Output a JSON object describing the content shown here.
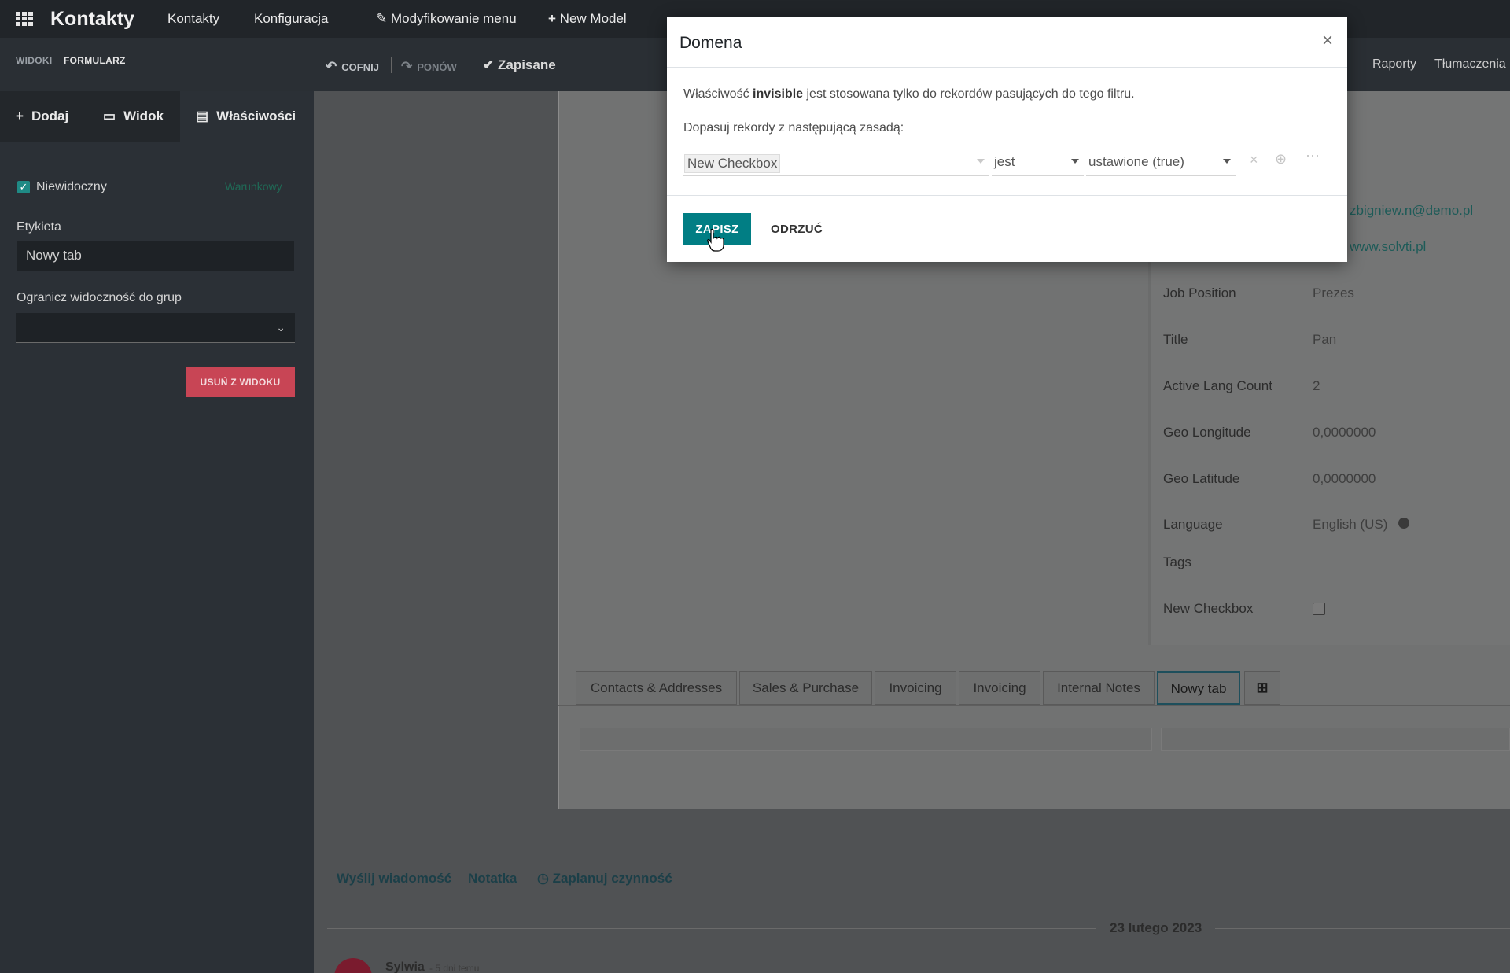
{
  "topbar": {
    "app_name": "Kontakty",
    "nav": [
      "Kontakty",
      "Konfiguracja",
      "Modyfikowanie menu",
      "New Model"
    ]
  },
  "studio": {
    "breadcrumb": [
      "WIDOKI",
      "FORMULARZ"
    ],
    "undo": "COFNIJ",
    "redo": "PONÓW",
    "saved": "Zapisane",
    "right_nav": [
      "Raporty",
      "Tłumaczenia"
    ]
  },
  "sidebar": {
    "tabs": [
      "Dodaj",
      "Widok",
      "Właściwości"
    ],
    "invisible_label": "Niewidoczny",
    "conditional_label": "Warunkowy",
    "label_heading": "Etykieta",
    "label_value": "Nowy tab",
    "groups_heading": "Ogranicz widoczność do grup",
    "remove_button": "USUŃ Z WIDOKU"
  },
  "form": {
    "email": "zbigniew.n@demo.pl",
    "website": "www.solvti.pl",
    "fields": [
      {
        "label": "Job Position",
        "value": "Prezes"
      },
      {
        "label": "Title",
        "value": "Pan"
      },
      {
        "label": "Active Lang Count",
        "value": "2"
      },
      {
        "label": "Geo Longitude",
        "value": "0,0000000"
      },
      {
        "label": "Geo Latitude",
        "value": "0,0000000"
      },
      {
        "label": "Language",
        "value": "English (US)"
      },
      {
        "label": "Tags",
        "value": ""
      },
      {
        "label": "New Checkbox",
        "value": ""
      }
    ],
    "tabs": [
      "Contacts & Addresses",
      "Sales & Purchase",
      "Invoicing",
      "Invoicing",
      "Internal Notes",
      "Nowy tab"
    ],
    "active_tab": "Nowy tab"
  },
  "chatter": {
    "send_message": "Wyślij wiadomość",
    "note": "Notatka",
    "schedule": "Zaplanuj czynność",
    "date": "23 lutego 2023",
    "author": "Sylwia",
    "time": "- 5 dni temu"
  },
  "modal": {
    "title": "Domena",
    "close": "×",
    "desc_prefix": "Właściwość",
    "desc_bold": "invisible",
    "desc_suffix": "jest stosowana tylko do rekordów pasujących do tego filtru.",
    "rule_label": "Dopasuj rekordy z następującą zasadą:",
    "field": "New Checkbox",
    "operator": "jest",
    "value": "ustawione (true)",
    "save": "ZAPISZ",
    "discard": "ODRZUĆ"
  },
  "colors": {
    "primary": "#017e84",
    "danger": "#c84555",
    "topbar": "#212529"
  }
}
